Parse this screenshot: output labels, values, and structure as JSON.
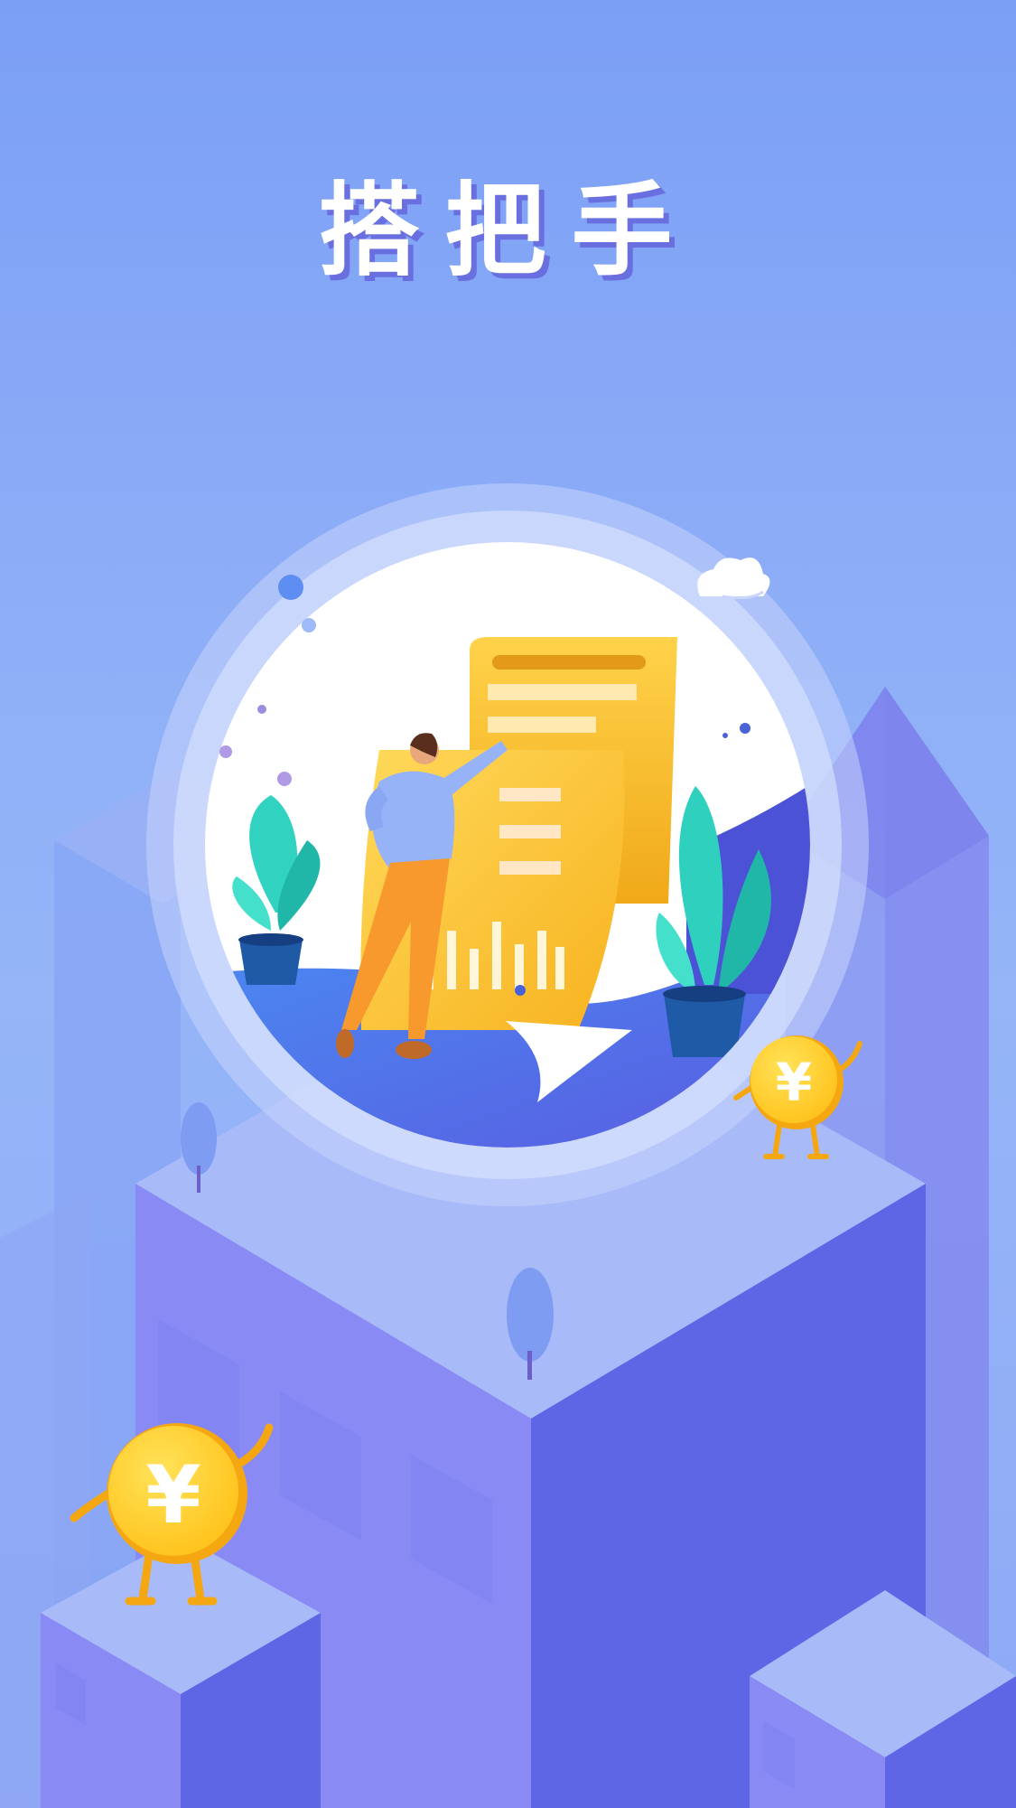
{
  "app": {
    "title": "搭把手"
  },
  "icons": {
    "coin_symbol": "¥",
    "icons_shown": [
      "yuan-coin-character-icon",
      "cloud-icon",
      "potted-plant-icon",
      "tree-icon"
    ]
  },
  "colors": {
    "background_top": "#7b9ff5",
    "building_light": "#a9baf9",
    "building_mid": "#8a8af5",
    "building_dark": "#5f66e6",
    "coin": "#ffd02c",
    "coin_edge": "#f5a712",
    "plant": "#31d3c0",
    "pot": "#1f5aa6",
    "document": "#ffc93b",
    "title_shadow": "#6a6fe0"
  }
}
